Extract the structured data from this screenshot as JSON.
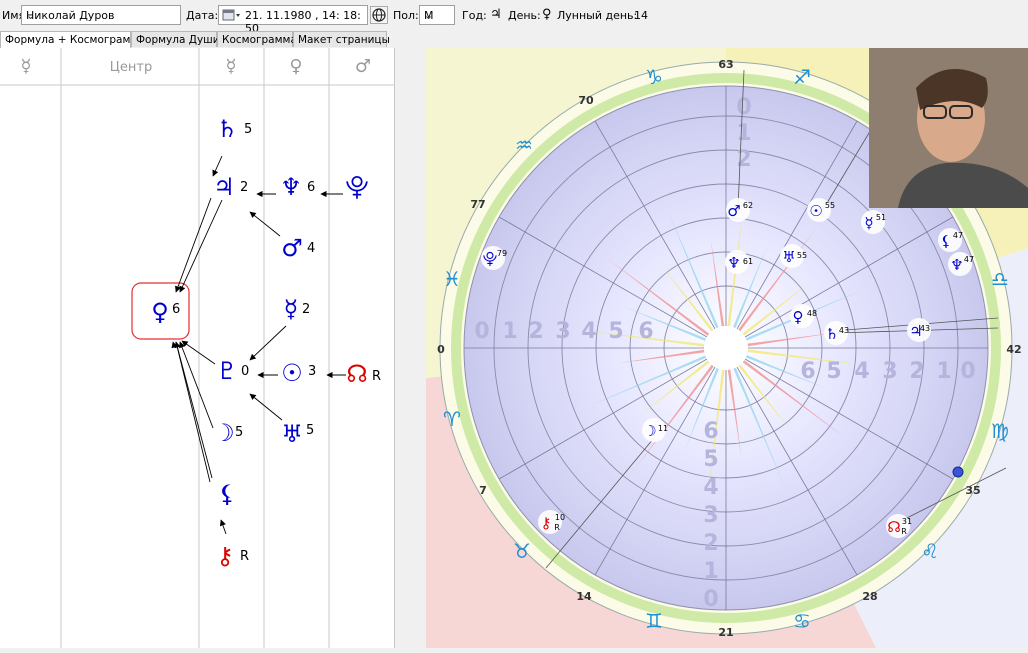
{
  "toolbar": {
    "name_label": "Имя:",
    "name_value": "Николай Дуров",
    "date_label": "Дата:",
    "date_value": "21. 11.1980 , 14: 18: 50",
    "sex_label": "Пол:",
    "sex_value": "М",
    "year_label": "Год:",
    "year_symbol": "♃",
    "day_label": "День:",
    "day_symbol": "♀",
    "lunar_label": "Лунный день:",
    "lunar_value": "14"
  },
  "tabs": [
    {
      "label": "Формула + Космограмма",
      "active": true
    },
    {
      "label": "Формула Души",
      "active": false
    },
    {
      "label": "Космограмма",
      "active": false
    },
    {
      "label": "Макет страницы",
      "active": false
    }
  ],
  "formula": {
    "headers": [
      "☿",
      "Центр",
      "☿",
      "♀",
      "♂"
    ],
    "planets": [
      {
        "glyph": "♄",
        "num": "5",
        "color": "#0000cc"
      },
      {
        "glyph": "♃",
        "num": "2",
        "color": "#0000cc"
      },
      {
        "glyph": "♆",
        "num": "6",
        "color": "#0000cc"
      },
      {
        "glyph": "⯓",
        "num": "",
        "color": "#0000cc"
      },
      {
        "glyph": "♂",
        "num": "4",
        "color": "#0000cc"
      },
      {
        "glyph": "♀",
        "num": "6",
        "color": "#0000cc"
      },
      {
        "glyph": "☿",
        "num": "2",
        "color": "#0000cc"
      },
      {
        "glyph": "♇",
        "num": "0",
        "color": "#0000cc"
      },
      {
        "glyph": "☉",
        "num": "3",
        "color": "#0000cc"
      },
      {
        "glyph": "☊",
        "num": "R",
        "color": "#dd0000"
      },
      {
        "glyph": "☽",
        "num": "5",
        "color": "#0000cc"
      },
      {
        "glyph": "♅",
        "num": "5",
        "color": "#0000cc"
      },
      {
        "glyph": "⚸",
        "num": "",
        "color": "#0000cc"
      },
      {
        "glyph": "⚷",
        "num": "R",
        "color": "#dd0000"
      }
    ]
  },
  "cosmogram": {
    "outer_numbers": [
      "63",
      "70",
      "77",
      "0",
      "7",
      "14",
      "21",
      "28",
      "35",
      "42"
    ],
    "zodiac": [
      "♑",
      "♐",
      "♒",
      "♓",
      "♈",
      "♉",
      "♊",
      "♋",
      "♌",
      "♍",
      "♎"
    ],
    "ring_digits": [
      "0",
      "1",
      "2",
      "3",
      "4",
      "5",
      "6"
    ],
    "planets": [
      {
        "glyph": "♂",
        "deg": "62",
        "r": ""
      },
      {
        "glyph": "☉",
        "deg": "55",
        "r": ""
      },
      {
        "glyph": "☿",
        "deg": "51",
        "r": ""
      },
      {
        "glyph": "⚸",
        "deg": "47",
        "r": ""
      },
      {
        "glyph": "♆",
        "deg": "47",
        "r": ""
      },
      {
        "glyph": "⯓",
        "deg": "79",
        "r": ""
      },
      {
        "glyph": "♆",
        "deg": "61",
        "r": ""
      },
      {
        "glyph": "♅",
        "deg": "55",
        "r": ""
      },
      {
        "glyph": "♀",
        "deg": "48",
        "r": ""
      },
      {
        "glyph": "♄",
        "deg": "43",
        "r": ""
      },
      {
        "glyph": "♃",
        "deg": "43",
        "r": ""
      },
      {
        "glyph": "☽",
        "deg": "11",
        "r": ""
      },
      {
        "glyph": "⚷",
        "deg": "10",
        "r": "R"
      },
      {
        "glyph": "☊",
        "deg": "31",
        "r": "R"
      }
    ]
  },
  "colors": {
    "planet_blue": "#0000cc",
    "planet_red": "#dd0000",
    "center_box": "#e03030",
    "zodiac_blue": "#1e8fd0"
  }
}
